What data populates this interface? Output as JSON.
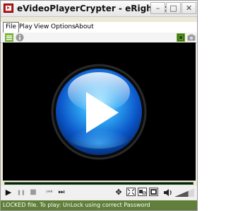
{
  "window": {
    "title": "eVideoPlayerCrypter - eRightSoft",
    "minimize_glyph": "–",
    "maximize_glyph": "□",
    "close_glyph": "✕"
  },
  "menu": {
    "items": [
      {
        "label": "File"
      },
      {
        "label": "Play"
      },
      {
        "label": "View"
      },
      {
        "label": "Options"
      },
      {
        "label": "About"
      }
    ]
  },
  "toolbar": {
    "left_icons": [
      "list-icon",
      "info-icon"
    ],
    "right_icons": [
      "snapshot-icon",
      "camera-icon"
    ]
  },
  "player": {
    "center_icon": "play-orb-icon",
    "seek_progress": 0.0
  },
  "controls": {
    "play_glyph": "▶",
    "pause_glyph": "❚❚",
    "stop_glyph": "■",
    "prev_glyph": "⏮",
    "next_glyph": "⏭",
    "move_glyph": "✥",
    "volume_level": 0.7
  },
  "status": {
    "text": "LOCKED file. To play: UnLock using correct Password"
  },
  "colors": {
    "status_bg": "#5f7f3a",
    "accent_green": "#3a8a2a",
    "orb_blue": "#1a7fe0"
  }
}
